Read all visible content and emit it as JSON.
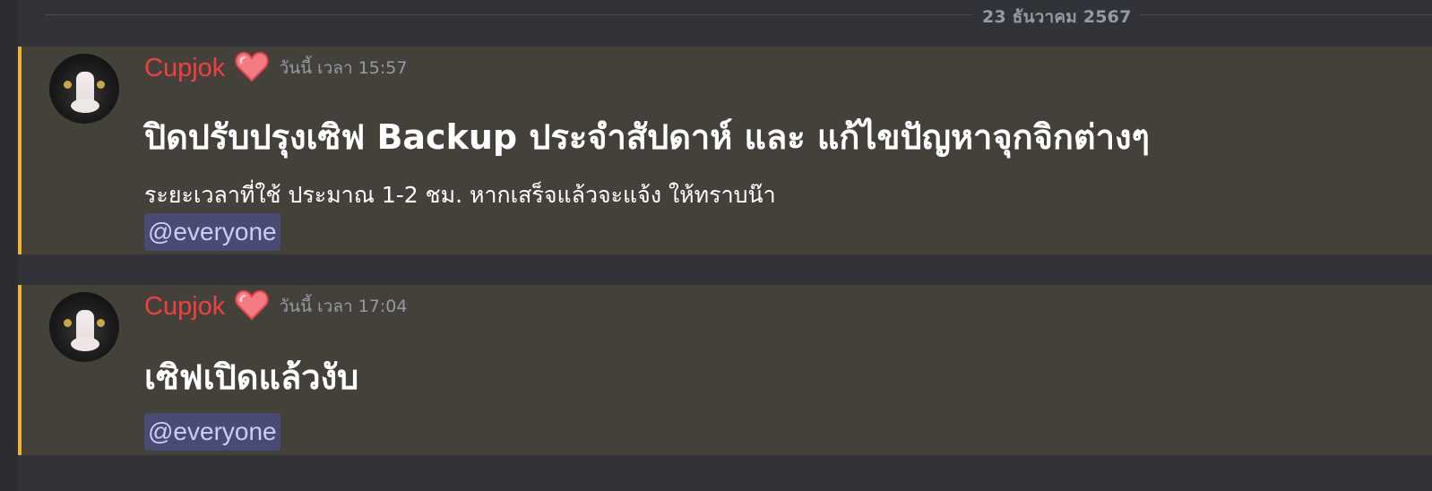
{
  "date_divider": "23 ธันวาคม 2567",
  "colors": {
    "background": "#313338",
    "message_highlight": "#44413b",
    "highlight_bar": "#f0b232",
    "username": "#f23f42",
    "mention_text": "#c9cdfb"
  },
  "messages": [
    {
      "username": "Cupjok",
      "badge_icon": "heart-icon",
      "timestamp": "วันนี้ เวลา 15:57",
      "title": "ปิดปรับปรุงเซิฟ Backup ประจำสัปดาห์ และ แก้ไขปัญหาจุกจิกต่างๆ",
      "body": "ระยะเวลาที่ใช้ ประมาณ 1-2 ชม. หากเสร็จแล้วจะแจ้ง ให้ทราบน๊า",
      "mention": "@everyone"
    },
    {
      "username": "Cupjok",
      "badge_icon": "heart-icon",
      "timestamp": "วันนี้ เวลา 17:04",
      "title": "เซิฟเปิดแล้วงับ",
      "mention": "@everyone"
    }
  ]
}
